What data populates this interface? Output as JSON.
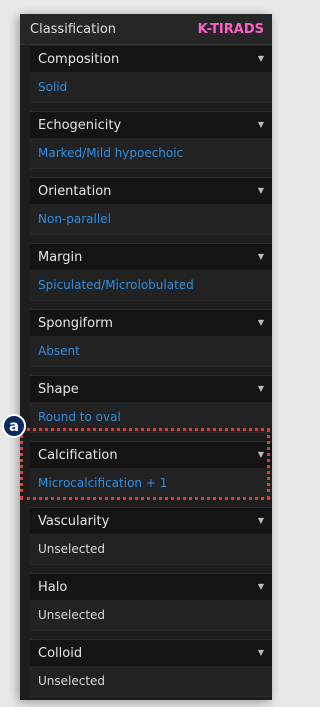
{
  "header": {
    "title": "Classification",
    "mode": "K-TIRADS"
  },
  "badge": "a",
  "sections": [
    {
      "label": "Composition",
      "value": "Solid"
    },
    {
      "label": "Echogenicity",
      "value": "Marked/Mild hypoechoic"
    },
    {
      "label": "Orientation",
      "value": "Non-parallel"
    },
    {
      "label": "Margin",
      "value": "Spiculated/Microlobulated"
    },
    {
      "label": "Spongiform",
      "value": "Absent"
    },
    {
      "label": "Shape",
      "value": "Round to oval"
    },
    {
      "label": "Calcification",
      "value": "Microcalcification + 1"
    },
    {
      "label": "Vascularity",
      "value": "Unselected"
    },
    {
      "label": "Halo",
      "value": "Unselected"
    },
    {
      "label": "Colloid",
      "value": "Unselected"
    }
  ],
  "colors": {
    "accent_pink": "#ff5fc8",
    "selected_blue": "#2f8fe0",
    "highlight_red": "#e23b3b"
  }
}
